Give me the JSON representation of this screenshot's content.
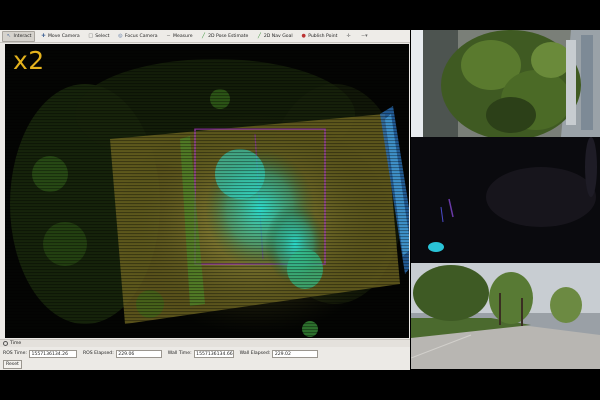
{
  "toolbar": {
    "tools": [
      {
        "label": "Interact",
        "icon": "cursor-icon",
        "active": true
      },
      {
        "label": "Move Camera",
        "icon": "move-camera-icon",
        "active": false
      },
      {
        "label": "Select",
        "icon": "select-icon",
        "active": false
      },
      {
        "label": "Focus Camera",
        "icon": "focus-camera-icon",
        "active": false
      },
      {
        "label": "Measure",
        "icon": "measure-icon",
        "active": false
      },
      {
        "label": "2D Pose Estimate",
        "icon": "pose-estimate-icon",
        "active": false
      },
      {
        "label": "2D Nav Goal",
        "icon": "nav-goal-icon",
        "active": false
      },
      {
        "label": "Publish Point",
        "icon": "publish-point-icon",
        "active": false
      }
    ]
  },
  "viewport": {
    "speed_label": "x2",
    "speed_color": "#e3b21d"
  },
  "time_panel": {
    "title": "Time",
    "ros_time_label": "ROS Time:",
    "ros_time_value": "1557136134.26",
    "ros_elapsed_label": "ROS Elapsed:",
    "ros_elapsed_value": "229.06",
    "wall_time_label": "Wall Time:",
    "wall_time_value": "1557136134.66",
    "wall_elapsed_label": "Wall Elapsed:",
    "wall_elapsed_value": "229.02",
    "reset_label": "Reset"
  }
}
